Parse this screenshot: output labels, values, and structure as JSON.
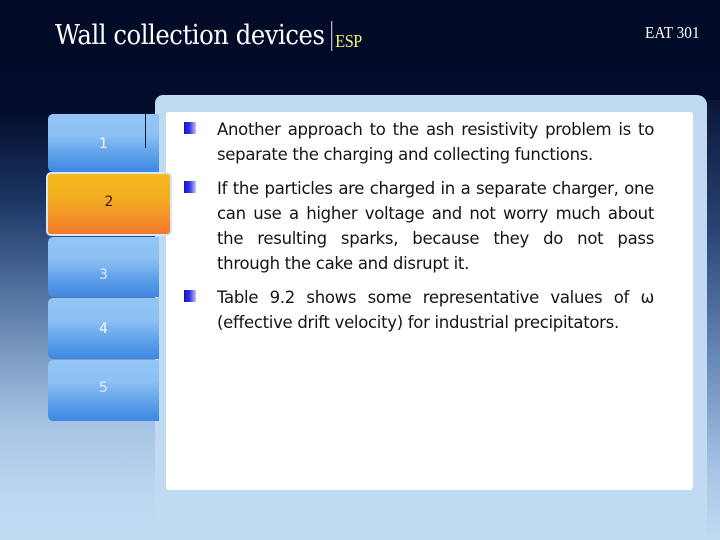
{
  "header": {
    "title": "Wall collection devices",
    "subtitle": "ESP",
    "course_code": "EAT 301"
  },
  "tabs": [
    {
      "label": "1",
      "active": false
    },
    {
      "label": "2",
      "active": true
    },
    {
      "label": "3",
      "active": false
    },
    {
      "label": "4",
      "active": false
    },
    {
      "label": "5",
      "active": false
    }
  ],
  "content": {
    "bullets": [
      "Another approach to the ash resistivity problem is to separate the charging and collecting functions.",
      "If the particles are charged in a separate charger, one can use a higher voltage and not worry much about the resulting sparks, because they do not pass through the cake and disrupt it.",
      "Table 9.2 shows some representative values of ω (effective drift velocity) for industrial precipitators."
    ]
  },
  "colors": {
    "background_top": "#020a26",
    "background_bottom": "#c0daf2",
    "tab_blue": "#5ea0ea",
    "tab_active_orange": "#f4ad22",
    "subtitle_yellow": "#f2f07a",
    "bullet_blue": "#1010d0"
  }
}
